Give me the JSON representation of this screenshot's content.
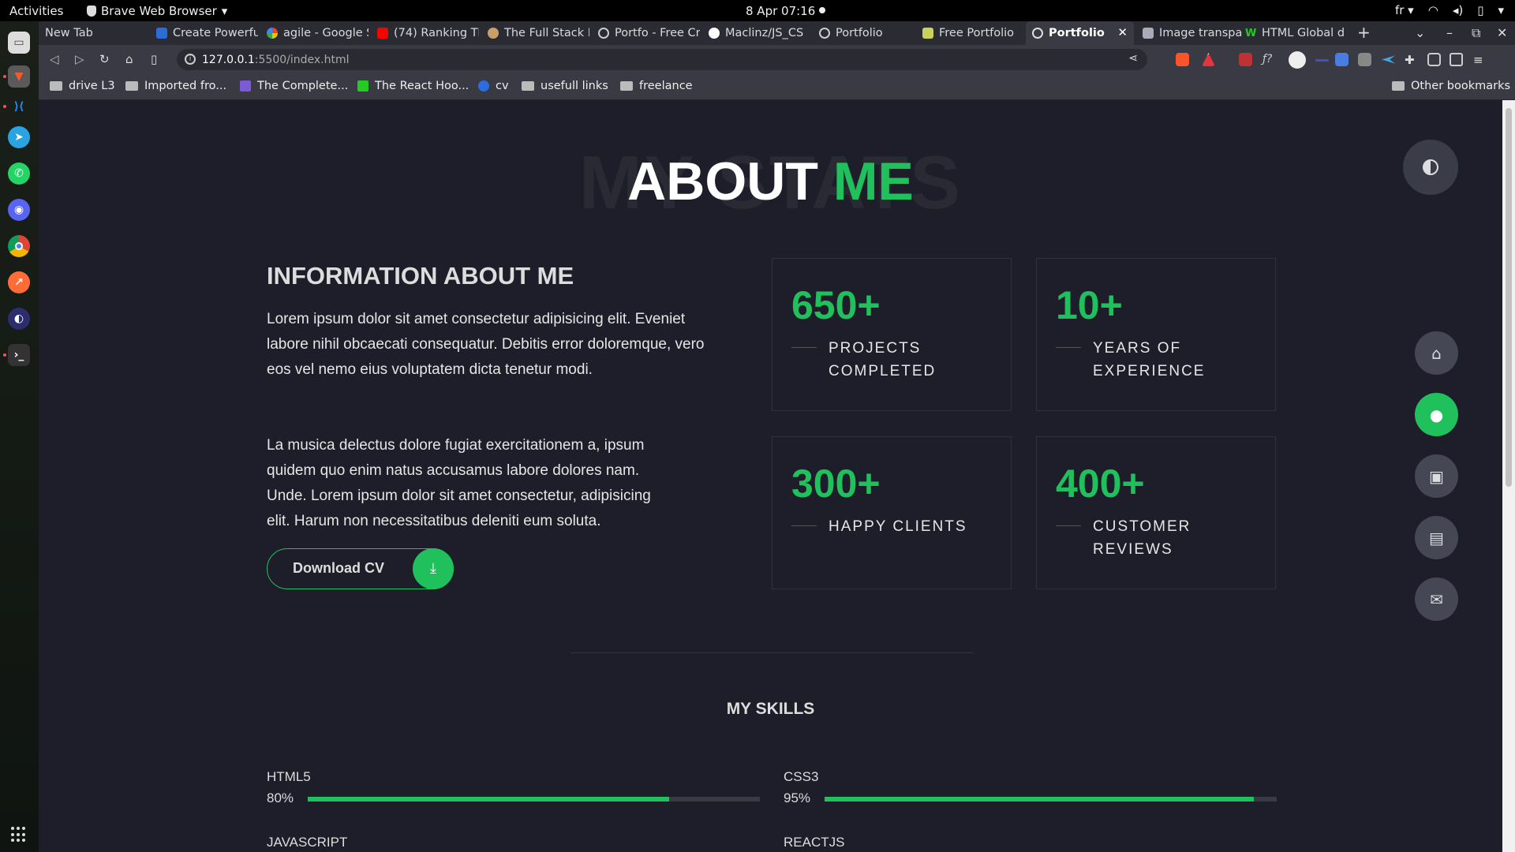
{
  "os": {
    "activities": "Activities",
    "app_name": "Brave Web Browser",
    "clock": "8 Apr  07:16",
    "lang": "fr"
  },
  "tabs": [
    {
      "title": "New Tab"
    },
    {
      "title": "Create Powerfu"
    },
    {
      "title": "agile - Google S"
    },
    {
      "title": "(74) Ranking Th"
    },
    {
      "title": "The Full Stack R"
    },
    {
      "title": "Portfo - Free Cr"
    },
    {
      "title": "Maclinz/JS_CS"
    },
    {
      "title": "Portfolio"
    },
    {
      "title": "Free Portfolio"
    },
    {
      "title": "Portfolio",
      "active": true
    },
    {
      "title": "Image transpa"
    },
    {
      "title": "HTML Global d"
    }
  ],
  "address": {
    "host": "127.0.0.1",
    "path": ":5500/index.html"
  },
  "bookmarks": [
    {
      "label": "drive L3"
    },
    {
      "label": "Imported fro..."
    },
    {
      "label": "The Complete..."
    },
    {
      "label": "The React Hoo..."
    },
    {
      "label": "cv"
    },
    {
      "label": "usefull links"
    },
    {
      "label": "freelance"
    }
  ],
  "other_bookmarks": "Other bookmarks",
  "about": {
    "bg_text": "MY STATS",
    "title_main": "ABOUT",
    "title_accent": "ME",
    "info_title": "INFORMATION ABOUT ME",
    "para1": "Lorem ipsum dolor sit amet consectetur adipisicing elit. Eveniet labore nihil obcaecati consequatur. Debitis error doloremque, vero eos vel nemo eius voluptatem dicta tenetur modi.",
    "para2": "La musica delectus dolore fugiat exercitationem a, ipsum quidem quo enim natus accusamus labore dolores nam. Unde. Lorem ipsum dolor sit amet consectetur, adipisicing elit. Harum non necessitatibus deleniti eum soluta.",
    "download_label": "Download CV"
  },
  "stats": [
    {
      "number": "650+",
      "label": "PROJECTS COMPLETED"
    },
    {
      "number": "10+",
      "label": "YEARS OF EXPERIENCE"
    },
    {
      "number": "300+",
      "label": "HAPPY CLIENTS"
    },
    {
      "number": "400+",
      "label": "CUSTOMER REVIEWS"
    }
  ],
  "skills_title": "MY SKILLS",
  "skills": [
    {
      "name": "HTML5",
      "percent_label": "80%",
      "level": 0.8
    },
    {
      "name": "CSS3",
      "percent_label": "95%",
      "level": 0.95
    },
    {
      "name": "JAVASCRIPT"
    },
    {
      "name": "REACTJS"
    }
  ],
  "colors": {
    "accent": "#20c05c",
    "background": "#1e1e2b"
  },
  "side_nav": [
    {
      "icon": "home-icon"
    },
    {
      "icon": "user-icon",
      "active": true
    },
    {
      "icon": "briefcase-icon"
    },
    {
      "icon": "newspaper-icon"
    },
    {
      "icon": "envelope-icon"
    }
  ]
}
